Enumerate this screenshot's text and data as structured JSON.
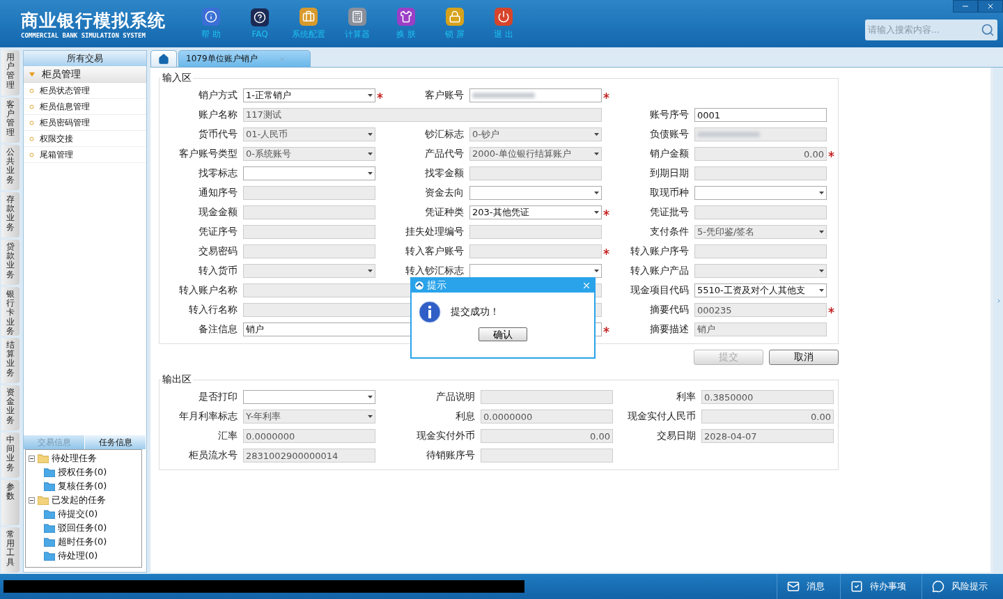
{
  "app": {
    "title": "商业银行模拟系统",
    "subtitle": "COMMERCIAL BANK SIMULATION SYSTEM"
  },
  "toolbar": [
    {
      "kind": "info",
      "label": "帮 助"
    },
    {
      "kind": "help",
      "label": "FAQ"
    },
    {
      "kind": "config",
      "label": "系统配置"
    },
    {
      "kind": "calc",
      "label": "计算器"
    },
    {
      "kind": "skin",
      "label": "换 肤"
    },
    {
      "kind": "lock",
      "label": "锁 屏"
    },
    {
      "kind": "exit",
      "label": "退 出"
    }
  ],
  "search": {
    "placeholder": "请输入搜索内容..."
  },
  "side_tabs": [
    "用户管理",
    "客户管理",
    "公共业务",
    "存款业务",
    "贷款业务",
    "银行卡业务",
    "结算业务",
    "资金业务",
    "中间业务",
    "参数",
    "常用工具"
  ],
  "menu": {
    "title": "所有交易",
    "group": {
      "label": "柜员管理",
      "expanded": true
    },
    "items": [
      "柜员状态管理",
      "柜员信息管理",
      "柜员密码管理",
      "权限交接",
      "尾箱管理"
    ]
  },
  "task_panel": {
    "tabs": [
      {
        "label": "交易信息",
        "selected": false
      },
      {
        "label": "任务信息",
        "selected": true
      }
    ],
    "tree": [
      {
        "label": "待处理任务",
        "expanded": true,
        "children": [
          {
            "label": "授权任务(0)"
          },
          {
            "label": "复核任务(0)"
          }
        ]
      },
      {
        "label": "已发起的任务",
        "expanded": true,
        "children": [
          {
            "label": "待提交(0)"
          },
          {
            "label": "驳回任务(0)"
          },
          {
            "label": "超时任务(0)"
          },
          {
            "label": "待处理(0)"
          }
        ]
      }
    ]
  },
  "page_tabs": [
    {
      "kind": "home",
      "selected": false
    },
    {
      "kind": "page",
      "label": "1079单位账户销户",
      "selected": true
    }
  ],
  "input_section": {
    "title": "输入区",
    "rows": [
      [
        {
          "label": "销户方式",
          "kind": "select",
          "value": "1-正常销户",
          "editable": true,
          "required": true
        },
        {
          "label": "客户账号",
          "kind": "text",
          "masked": true,
          "editable": true,
          "required": true
        },
        null
      ],
      [
        {
          "label": "账户名称",
          "kind": "text",
          "value": "117测试",
          "editable": false,
          "wide": true
        },
        {
          "label": "账号序号",
          "kind": "text",
          "value": "0001",
          "editable": true
        }
      ],
      [
        {
          "label": "货币代号",
          "kind": "select",
          "value": "01-人民币",
          "editable": false
        },
        {
          "label": "钞汇标志",
          "kind": "select",
          "value": "0-钞户",
          "editable": false
        },
        {
          "label": "负债账号",
          "kind": "text",
          "masked": true,
          "editable": false
        }
      ],
      [
        {
          "label": "客户账号类型",
          "kind": "select",
          "value": "0-系统账号",
          "editable": false
        },
        {
          "label": "产品代号",
          "kind": "select",
          "value": "2000-单位银行结算账户",
          "editable": false
        },
        {
          "label": "销户金额",
          "kind": "text",
          "value": "0.00",
          "right_aligned": true,
          "editable": false,
          "required": true
        }
      ],
      [
        {
          "label": "找零标志",
          "kind": "select",
          "editable": true
        },
        {
          "label": "找零金额",
          "kind": "text",
          "editable": false
        },
        {
          "label": "到期日期",
          "kind": "text",
          "editable": false
        }
      ],
      [
        {
          "label": "通知序号",
          "kind": "text",
          "editable": false
        },
        {
          "label": "资金去向",
          "kind": "select",
          "editable": true
        },
        {
          "label": "取现币种",
          "kind": "select",
          "editable": true
        }
      ],
      [
        {
          "label": "现金金额",
          "kind": "text",
          "editable": false
        },
        {
          "label": "凭证种类",
          "kind": "select",
          "value": "203-其他凭证",
          "editable": true,
          "required": true
        },
        {
          "label": "凭证批号",
          "kind": "text",
          "editable": false
        }
      ],
      [
        {
          "label": "凭证序号",
          "kind": "text",
          "editable": false
        },
        {
          "label": "挂失处理编号",
          "kind": "text",
          "editable": false
        },
        {
          "label": "支付条件",
          "kind": "select",
          "value": "5-凭印鉴/签名",
          "editable": false
        }
      ],
      [
        {
          "label": "交易密码",
          "kind": "text",
          "editable": false
        },
        {
          "label": "转入客户账号",
          "kind": "text",
          "editable": false,
          "required": true
        },
        {
          "label": "转入账户序号",
          "kind": "text",
          "editable": false
        }
      ],
      [
        {
          "label": "转入货币",
          "kind": "select",
          "editable": false
        },
        {
          "label": "转入钞汇标志",
          "kind": "select",
          "editable": true
        },
        {
          "label": "转入账户产品",
          "kind": "select",
          "editable": false
        }
      ],
      [
        {
          "label": "转入账户名称",
          "kind": "text",
          "editable": false,
          "wide": true
        },
        {
          "label": "现金项目代码",
          "kind": "select",
          "value": "5510-工资及对个人其他支",
          "editable": true
        }
      ],
      [
        {
          "label": "转入行名称",
          "kind": "text",
          "editable": false,
          "wide": true
        },
        {
          "label": "摘要代码",
          "kind": "text",
          "value": "000235",
          "editable": false,
          "required": true
        }
      ],
      [
        {
          "label": "备注信息",
          "kind": "text",
          "value": "销户",
          "editable": true,
          "wide": true,
          "required": true
        },
        {
          "label": "摘要描述",
          "kind": "text",
          "value": "销户",
          "editable": false
        }
      ]
    ]
  },
  "actions": [
    {
      "label": "提交",
      "disabled": true
    },
    {
      "label": "取消",
      "disabled": false
    }
  ],
  "output_section": {
    "title": "输出区",
    "rows": [
      [
        {
          "label": "是否打印",
          "kind": "select",
          "editable": true
        },
        {
          "label": "产品说明",
          "kind": "text",
          "editable": false
        },
        {
          "label": "利率",
          "kind": "text",
          "value": "0.3850000",
          "editable": false
        }
      ],
      [
        {
          "label": "年月利率标志",
          "kind": "select",
          "value": "Y-年利率",
          "editable": false
        },
        {
          "label": "利息",
          "kind": "text",
          "value": "0.0000000",
          "editable": false
        },
        {
          "label": "现金实付人民币",
          "kind": "text",
          "value": "0.00",
          "right_aligned": true,
          "editable": false
        }
      ],
      [
        {
          "label": "汇率",
          "kind": "text",
          "value": "0.0000000",
          "editable": false
        },
        {
          "label": "现金实付外币",
          "kind": "text",
          "value": "0.00",
          "right_aligned": true,
          "editable": false
        },
        {
          "label": "交易日期",
          "kind": "text",
          "value": "2028-04-07",
          "editable": false
        }
      ],
      [
        {
          "label": "柜员流水号",
          "kind": "text",
          "value": "2831002900000014",
          "editable": false
        },
        {
          "label": "待销账序号",
          "kind": "text",
          "editable": false
        },
        null
      ]
    ]
  },
  "dialog": {
    "title": "提示",
    "message": "提交成功！",
    "button": "确认"
  },
  "status_bar": [
    {
      "kind": "mail",
      "label": "消息"
    },
    {
      "kind": "todo",
      "label": "待办事项"
    },
    {
      "kind": "risk",
      "label": "风险提示"
    }
  ]
}
